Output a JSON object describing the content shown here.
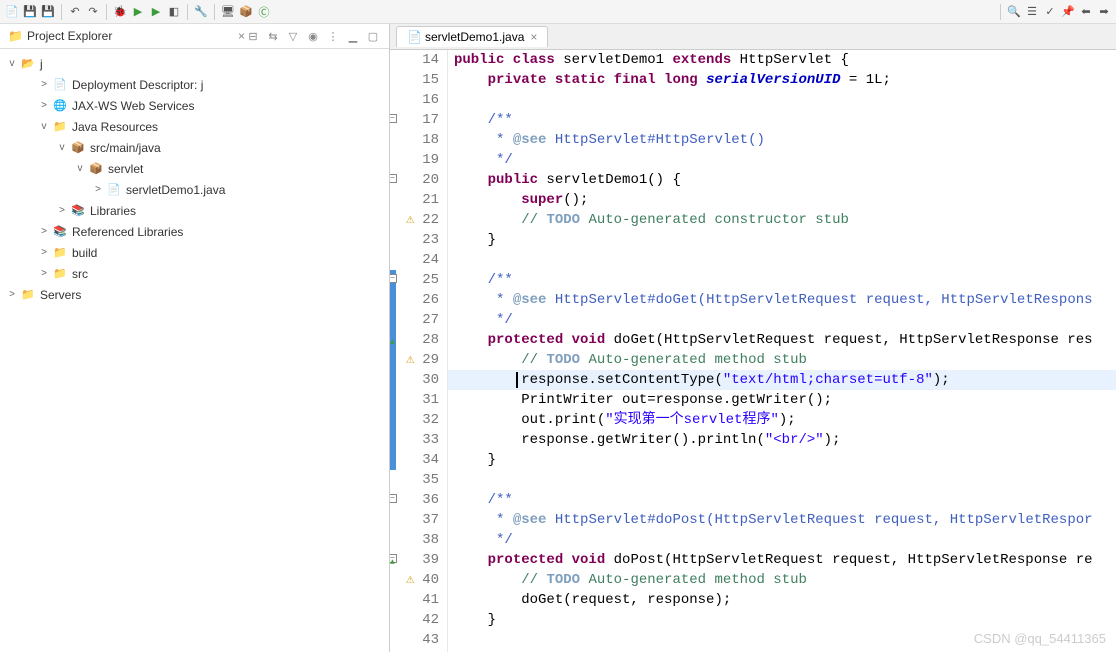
{
  "explorer": {
    "title": "Project Explorer",
    "root": "j",
    "nodes": [
      {
        "label": "Deployment Descriptor: j",
        "indent": 2,
        "twisty": ">",
        "icon": "📄"
      },
      {
        "label": "JAX-WS Web Services",
        "indent": 2,
        "twisty": ">",
        "icon": "🌐"
      },
      {
        "label": "Java Resources",
        "indent": 2,
        "twisty": "v",
        "icon": "📁"
      },
      {
        "label": "src/main/java",
        "indent": 3,
        "twisty": "v",
        "icon": "📦"
      },
      {
        "label": "servlet",
        "indent": 4,
        "twisty": "v",
        "icon": "📦"
      },
      {
        "label": "servletDemo1.java",
        "indent": 5,
        "twisty": ">",
        "icon": "📄"
      },
      {
        "label": "Libraries",
        "indent": 3,
        "twisty": ">",
        "icon": "📚"
      },
      {
        "label": "Referenced Libraries",
        "indent": 2,
        "twisty": ">",
        "icon": "📚"
      },
      {
        "label": "build",
        "indent": 2,
        "twisty": ">",
        "icon": "📁"
      },
      {
        "label": "src",
        "indent": 2,
        "twisty": ">",
        "icon": "📁"
      }
    ],
    "servers": "Servers"
  },
  "editor": {
    "tab_label": "servletDemo1.java",
    "lines": [
      {
        "n": "14",
        "marker": "",
        "code": [
          {
            "c": "kw",
            "t": "public class"
          },
          {
            "c": "plain",
            "t": " servletDemo1 "
          },
          {
            "c": "kw",
            "t": "extends"
          },
          {
            "c": "plain",
            "t": " HttpServlet {"
          }
        ]
      },
      {
        "n": "15",
        "marker": "",
        "code": [
          {
            "c": "plain",
            "t": "    "
          },
          {
            "c": "kw",
            "t": "private static final long"
          },
          {
            "c": "plain",
            "t": " "
          },
          {
            "c": "field",
            "t": "serialVersionUID"
          },
          {
            "c": "plain",
            "t": " = 1L;"
          }
        ]
      },
      {
        "n": "16",
        "marker": "",
        "code": [
          {
            "c": "plain",
            "t": ""
          }
        ]
      },
      {
        "n": "17",
        "marker": "fold",
        "code": [
          {
            "c": "plain",
            "t": "    "
          },
          {
            "c": "doc",
            "t": "/**"
          }
        ]
      },
      {
        "n": "18",
        "marker": "",
        "code": [
          {
            "c": "plain",
            "t": "     "
          },
          {
            "c": "doc",
            "t": "* "
          },
          {
            "c": "docann",
            "t": "@see"
          },
          {
            "c": "doc",
            "t": " HttpServlet#HttpServlet()"
          }
        ]
      },
      {
        "n": "19",
        "marker": "",
        "code": [
          {
            "c": "plain",
            "t": "     "
          },
          {
            "c": "doc",
            "t": "*/"
          }
        ]
      },
      {
        "n": "20",
        "marker": "fold",
        "code": [
          {
            "c": "plain",
            "t": "    "
          },
          {
            "c": "kw",
            "t": "public"
          },
          {
            "c": "plain",
            "t": " servletDemo1() {"
          }
        ]
      },
      {
        "n": "21",
        "marker": "",
        "code": [
          {
            "c": "plain",
            "t": "        "
          },
          {
            "c": "kw",
            "t": "super"
          },
          {
            "c": "plain",
            "t": "();"
          }
        ]
      },
      {
        "n": "22",
        "marker": "warn",
        "code": [
          {
            "c": "plain",
            "t": "        "
          },
          {
            "c": "cmt",
            "t": "// "
          },
          {
            "c": "todo",
            "t": "TODO"
          },
          {
            "c": "cmt",
            "t": " Auto-generated constructor stub"
          }
        ]
      },
      {
        "n": "23",
        "marker": "",
        "code": [
          {
            "c": "plain",
            "t": "    }"
          }
        ]
      },
      {
        "n": "24",
        "marker": "",
        "code": [
          {
            "c": "plain",
            "t": ""
          }
        ]
      },
      {
        "n": "25",
        "marker": "bluefold",
        "code": [
          {
            "c": "plain",
            "t": "    "
          },
          {
            "c": "doc",
            "t": "/**"
          }
        ]
      },
      {
        "n": "26",
        "marker": "blue",
        "code": [
          {
            "c": "plain",
            "t": "     "
          },
          {
            "c": "doc",
            "t": "* "
          },
          {
            "c": "docann",
            "t": "@see"
          },
          {
            "c": "doc",
            "t": " HttpServlet#doGet(HttpServletRequest request, HttpServletRespons"
          }
        ]
      },
      {
        "n": "27",
        "marker": "blue",
        "code": [
          {
            "c": "plain",
            "t": "     "
          },
          {
            "c": "doc",
            "t": "*/"
          }
        ]
      },
      {
        "n": "28",
        "marker": "bluegreen",
        "code": [
          {
            "c": "plain",
            "t": "    "
          },
          {
            "c": "kw",
            "t": "protected void"
          },
          {
            "c": "plain",
            "t": " doGet(HttpServletRequest request, HttpServletResponse res"
          }
        ]
      },
      {
        "n": "29",
        "marker": "bluewarn",
        "code": [
          {
            "c": "plain",
            "t": "        "
          },
          {
            "c": "cmt",
            "t": "// "
          },
          {
            "c": "todo",
            "t": "TODO"
          },
          {
            "c": "cmt",
            "t": " Auto-generated method stub"
          }
        ]
      },
      {
        "n": "30",
        "marker": "blue",
        "hl": true,
        "code": [
          {
            "c": "plain",
            "t": "        response.setContentType("
          },
          {
            "c": "str",
            "t": "\"text/html;charset=utf-8\""
          },
          {
            "c": "plain",
            "t": ");"
          }
        ]
      },
      {
        "n": "31",
        "marker": "blue",
        "code": [
          {
            "c": "plain",
            "t": "        PrintWriter out=response.getWriter();"
          }
        ]
      },
      {
        "n": "32",
        "marker": "blue",
        "code": [
          {
            "c": "plain",
            "t": "        out.print("
          },
          {
            "c": "str",
            "t": "\"实现第一个servlet程序\""
          },
          {
            "c": "plain",
            "t": ");"
          }
        ]
      },
      {
        "n": "33",
        "marker": "blue",
        "code": [
          {
            "c": "plain",
            "t": "        response.getWriter().println("
          },
          {
            "c": "str",
            "t": "\"<br/>\""
          },
          {
            "c": "plain",
            "t": ");"
          }
        ]
      },
      {
        "n": "34",
        "marker": "blue",
        "code": [
          {
            "c": "plain",
            "t": "    }"
          }
        ]
      },
      {
        "n": "35",
        "marker": "",
        "code": [
          {
            "c": "plain",
            "t": ""
          }
        ]
      },
      {
        "n": "36",
        "marker": "fold",
        "code": [
          {
            "c": "plain",
            "t": "    "
          },
          {
            "c": "doc",
            "t": "/**"
          }
        ]
      },
      {
        "n": "37",
        "marker": "",
        "code": [
          {
            "c": "plain",
            "t": "     "
          },
          {
            "c": "doc",
            "t": "* "
          },
          {
            "c": "docann",
            "t": "@see"
          },
          {
            "c": "doc",
            "t": " HttpServlet#doPost(HttpServletRequest request, HttpServletRespor"
          }
        ]
      },
      {
        "n": "38",
        "marker": "",
        "code": [
          {
            "c": "plain",
            "t": "     "
          },
          {
            "c": "doc",
            "t": "*/"
          }
        ]
      },
      {
        "n": "39",
        "marker": "greenfold",
        "code": [
          {
            "c": "plain",
            "t": "    "
          },
          {
            "c": "kw",
            "t": "protected void"
          },
          {
            "c": "plain",
            "t": " doPost(HttpServletRequest request, HttpServletResponse re"
          }
        ]
      },
      {
        "n": "40",
        "marker": "warn",
        "code": [
          {
            "c": "plain",
            "t": "        "
          },
          {
            "c": "cmt",
            "t": "// "
          },
          {
            "c": "todo",
            "t": "TODO"
          },
          {
            "c": "cmt",
            "t": " Auto-generated method stub"
          }
        ]
      },
      {
        "n": "41",
        "marker": "",
        "code": [
          {
            "c": "plain",
            "t": "        doGet(request, response);"
          }
        ]
      },
      {
        "n": "42",
        "marker": "",
        "code": [
          {
            "c": "plain",
            "t": "    }"
          }
        ]
      },
      {
        "n": "43",
        "marker": "",
        "code": [
          {
            "c": "plain",
            "t": ""
          }
        ]
      }
    ]
  },
  "watermark": "CSDN @qq_54411365"
}
